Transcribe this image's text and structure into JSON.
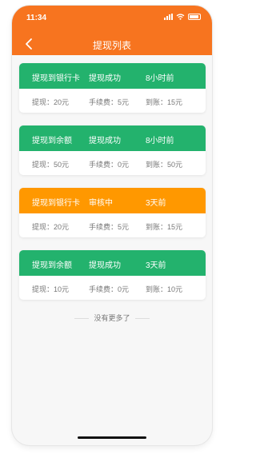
{
  "status_bar": {
    "time": "11:34"
  },
  "nav": {
    "title": "提现列表"
  },
  "colors": {
    "brand": "#f7741f",
    "success": "#23b26d",
    "pending": "#ff9800"
  },
  "records": [
    {
      "type": "提现到银行卡",
      "status": "提现成功",
      "time": "8小时前",
      "amount": "提现：20元",
      "fee": "手续费：5元",
      "received": "到账：15元",
      "color": "#23b26d"
    },
    {
      "type": "提现到余额",
      "status": "提现成功",
      "time": "8小时前",
      "amount": "提现：50元",
      "fee": "手续费：0元",
      "received": "到账：50元",
      "color": "#23b26d"
    },
    {
      "type": "提现到银行卡",
      "status": "审核中",
      "time": "3天前",
      "amount": "提现：20元",
      "fee": "手续费：5元",
      "received": "到账：15元",
      "color": "#ff9800"
    },
    {
      "type": "提现到余额",
      "status": "提现成功",
      "time": "3天前",
      "amount": "提现：10元",
      "fee": "手续费：0元",
      "received": "到账：10元",
      "color": "#23b26d"
    }
  ],
  "footer": {
    "no_more": "没有更多了"
  }
}
